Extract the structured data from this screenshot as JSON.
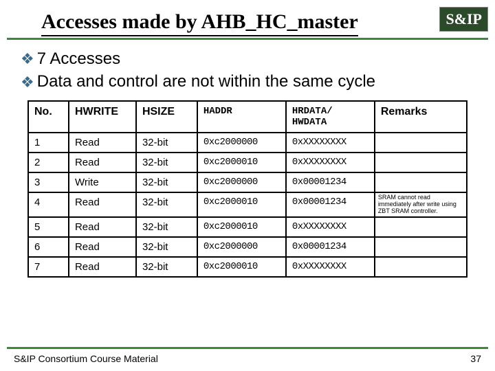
{
  "title": "Accesses made by AHB_HC_master",
  "logo": "S&IP",
  "bullets": [
    "7 Accesses",
    "Data and control are not within the same cycle"
  ],
  "table": {
    "headers": [
      "No.",
      "HWRITE",
      "HSIZE",
      "HADDR",
      "HRDATA/\nHWDATA",
      "Remarks"
    ],
    "rows": [
      {
        "no": "1",
        "hwrite": "Read",
        "hsize": "32-bit",
        "haddr": "0xc2000000",
        "hdata": "0xXXXXXXXX",
        "remarks": ""
      },
      {
        "no": "2",
        "hwrite": "Read",
        "hsize": "32-bit",
        "haddr": "0xc2000010",
        "hdata": "0xXXXXXXXX",
        "remarks": ""
      },
      {
        "no": "3",
        "hwrite": "Write",
        "hsize": "32-bit",
        "haddr": "0xc2000000",
        "hdata": "0x00001234",
        "remarks": ""
      },
      {
        "no": "4",
        "hwrite": "Read",
        "hsize": "32-bit",
        "haddr": "0xc2000010",
        "hdata": "0x00001234",
        "remarks": "SRAM cannot read immediately after write using ZBT SRAM controller."
      },
      {
        "no": "5",
        "hwrite": "Read",
        "hsize": "32-bit",
        "haddr": "0xc2000010",
        "hdata": "0xXXXXXXXX",
        "remarks": ""
      },
      {
        "no": "6",
        "hwrite": "Read",
        "hsize": "32-bit",
        "haddr": "0xc2000000",
        "hdata": "0x00001234",
        "remarks": ""
      },
      {
        "no": "7",
        "hwrite": "Read",
        "hsize": "32-bit",
        "haddr": "0xc2000010",
        "hdata": "0xXXXXXXXX",
        "remarks": ""
      }
    ]
  },
  "footer": "S&IP Consortium Course Material",
  "page": "37"
}
